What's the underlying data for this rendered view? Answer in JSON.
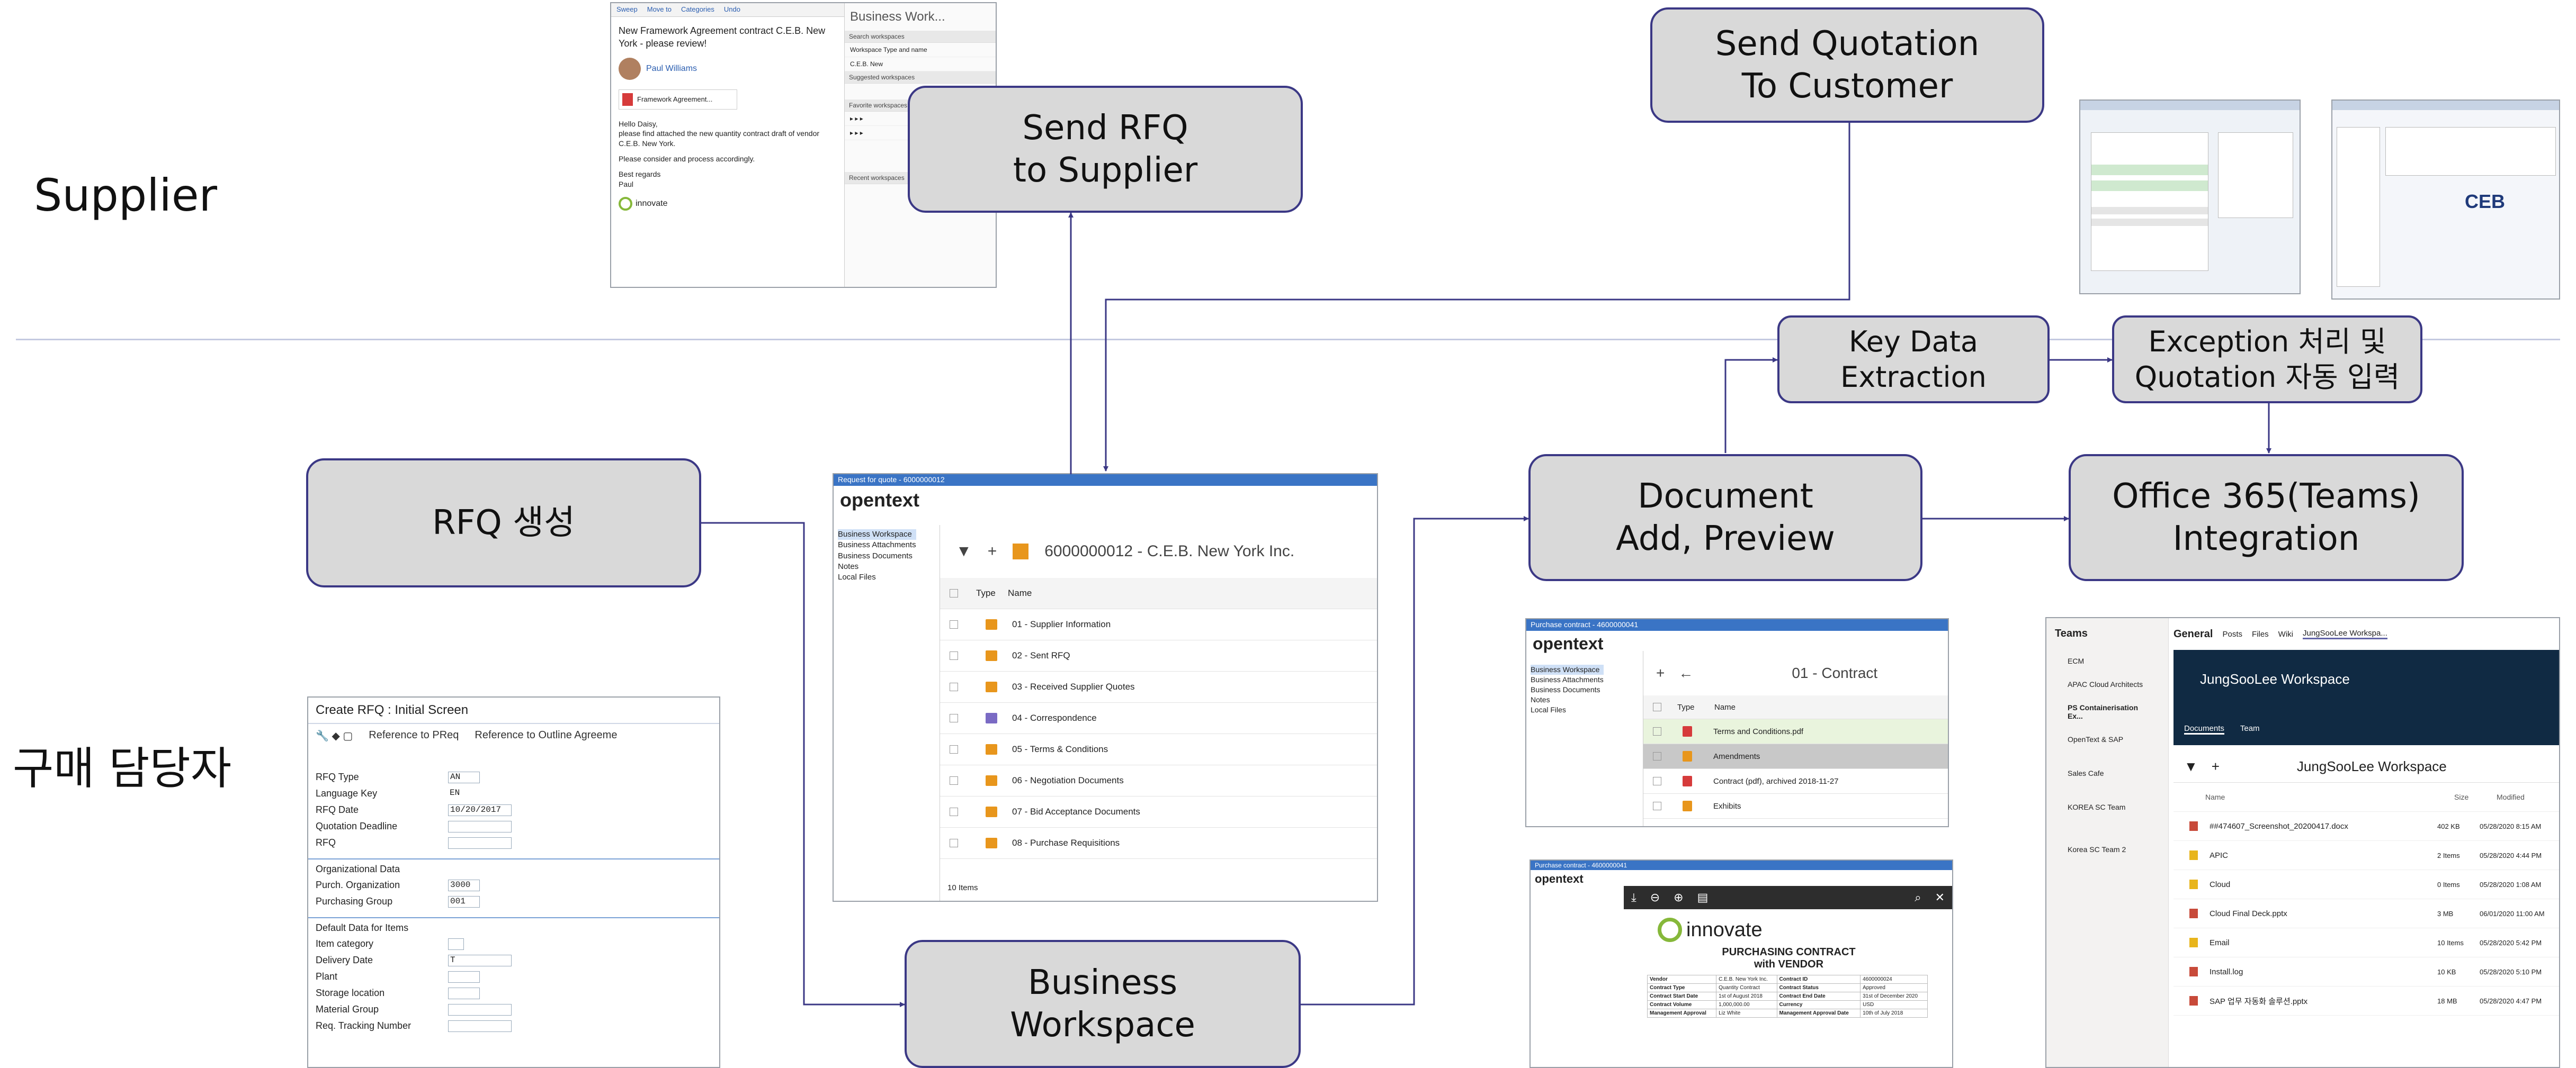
{
  "lanes": {
    "supplier": "Supplier",
    "buyer": "구매 담당자"
  },
  "nodes": {
    "send_rfq": "Send RFQ\nto Supplier",
    "send_quotation": "Send Quotation\nTo Customer",
    "key_data": "Key Data\nExtraction",
    "exception": "Exception 처리 및\nQuotation 자동 입력",
    "rfq_create": "RFQ 생성",
    "document": "Document\nAdd, Preview",
    "office365": "Office 365(Teams)\nIntegration",
    "business_workspace": "Business\nWorkspace"
  },
  "colors": {
    "node_fill": "#d9d9d9",
    "node_border": "#3b3885",
    "wire": "#3b3885",
    "divider": "#c4c9e0"
  },
  "email": {
    "toolbar": [
      "Sweep",
      "Move to",
      "Categories",
      "Undo"
    ],
    "subject": "New Framework Agreement contract C.E.B. New York - please review!",
    "sender": "Paul Williams",
    "attachment": "Framework Agreement...",
    "body_lines": [
      "Hello Daisy,",
      "please find attached the new quantity contract draft of vendor C.E.B. New York.",
      "Please consider and process accordingly.",
      "Best regards",
      "Paul"
    ],
    "company": "innovate",
    "pane_title": "Business Work...",
    "pane_rows": [
      "Search workspaces",
      "Workspace Type and name",
      "C.E.B. New",
      "Suggested workspaces",
      "Favorite workspaces",
      "Recent workspaces"
    ]
  },
  "workspace": {
    "window_title": "Request for quote - 6000000012",
    "logo": "opentext",
    "tree": [
      "Business Workspace",
      "Business Attachments",
      "Business Documents",
      "Notes",
      "Local Files"
    ],
    "header": "6000000012 - C.E.B. New York Inc.",
    "col_type": "Type",
    "col_name": "Name",
    "rows": [
      "01 - Supplier Information",
      "02 - Sent RFQ",
      "03 - Received Supplier Quotes",
      "04 - Correspondence",
      "05 - Terms & Conditions",
      "06 - Negotiation Documents",
      "07 - Bid Acceptance Documents",
      "08 - Purchase Requisitions"
    ],
    "footer": "10 Items"
  },
  "sap": {
    "title": "Create RFQ : Initial Screen",
    "toolbar": [
      "Reference to PReq",
      "Reference to Outline Agreeme"
    ],
    "fields": [
      {
        "label": "RFQ Type",
        "value": "AN"
      },
      {
        "label": "Language Key",
        "value": "EN"
      },
      {
        "label": "RFQ Date",
        "value": "10/20/2017"
      },
      {
        "label": "Quotation Deadline",
        "value": ""
      },
      {
        "label": "RFQ",
        "value": ""
      }
    ],
    "org_title": "Organizational Data",
    "org_fields": [
      {
        "label": "Purch. Organization",
        "value": "3000"
      },
      {
        "label": "Purchasing Group",
        "value": "001"
      }
    ],
    "default_title": "Default Data for Items",
    "default_fields": [
      {
        "label": "Item category",
        "value": ""
      },
      {
        "label": "Delivery Date",
        "value": "T"
      },
      {
        "label": "Plant",
        "value": ""
      },
      {
        "label": "Storage location",
        "value": ""
      },
      {
        "label": "Material Group",
        "value": ""
      },
      {
        "label": "Req. Tracking Number",
        "value": ""
      }
    ]
  },
  "contract": {
    "window_title": "Purchase contract - 4600000041",
    "logo": "opentext",
    "tree": [
      "Business Workspace",
      "Business Attachments",
      "Business Documents",
      "Notes",
      "Local Files"
    ],
    "header": "01 - Contract",
    "col_type": "Type",
    "col_name": "Name",
    "rows": [
      "Terms and Conditions.pdf",
      "Amendments",
      "Contract (pdf), archived 2018-11-27",
      "Exhibits"
    ]
  },
  "preview": {
    "window_title": "Purchase contract - 4600000041",
    "logo": "opentext",
    "company": "innovate",
    "doc_title": "PURCHASING CONTRACT",
    "doc_sub": "with VENDOR",
    "table": [
      [
        "Vendor",
        "C.E.B. New York Inc.",
        "Contract ID",
        "4600000024"
      ],
      [
        "Contract Type",
        "Quantity Contract",
        "Contract Status",
        "Approved"
      ],
      [
        "Contract Start Date",
        "1st of August 2018",
        "Contract End Date",
        "31st of December 2020"
      ],
      [
        "Contract Volume",
        "1,000,000.00",
        "Currency",
        "USD"
      ],
      [
        "Management Approval",
        "Liz White",
        "Management Approval Date",
        "10th of July 2018"
      ]
    ]
  },
  "teams": {
    "app": "Teams",
    "channel": "General",
    "tabs": [
      "Posts",
      "Files",
      "Wiki",
      "JungSooLee Workspa..."
    ],
    "teams_list": [
      "ECM",
      "APAC Cloud Architects",
      "PS Containerisation Ex...",
      "OpenText & SAP",
      "Sales Cafe",
      "KOREA SC Team",
      "Korea SC Team 2"
    ],
    "workspace_title": "JungSooLee Workspace",
    "sub_tabs": [
      "Documents",
      "Team"
    ],
    "col_name": "Name",
    "col_size": "Size",
    "col_modified": "Modified",
    "files": [
      {
        "name": "##474607_Screenshot_20200417.docx",
        "size": "402 KB",
        "modified": "05/28/2020 8:15 AM"
      },
      {
        "name": "APIC",
        "size": "2 Items",
        "modified": "05/28/2020 4:44 PM"
      },
      {
        "name": "Cloud",
        "size": "0 Items",
        "modified": "05/28/2020 1:08 AM"
      },
      {
        "name": "Cloud Final Deck.pptx",
        "size": "3 MB",
        "modified": "06/01/2020 11:00 AM"
      },
      {
        "name": "Email",
        "size": "10 Items",
        "modified": "05/28/2020 5:42 PM"
      },
      {
        "name": "Install.log",
        "size": "10 KB",
        "modified": "05/28/2020 5:10 PM"
      },
      {
        "name": "SAP 업무 자동화 솔루션.pptx",
        "size": "18 MB",
        "modified": "05/28/2020 4:47 PM"
      }
    ]
  }
}
